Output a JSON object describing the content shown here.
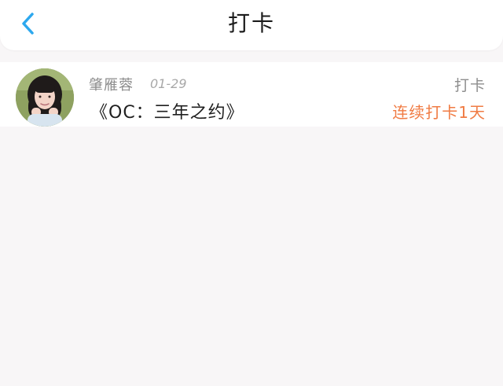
{
  "header": {
    "title": "打卡",
    "back_icon": "chevron-left-icon",
    "accent_color": "#2da8ee"
  },
  "checkin": {
    "user_name": "肇雁蓉",
    "date": "01-29",
    "book_title": "《OC：三年之约》",
    "status": "打卡",
    "streak": "连续打卡1天",
    "streak_color": "#f07b43"
  }
}
